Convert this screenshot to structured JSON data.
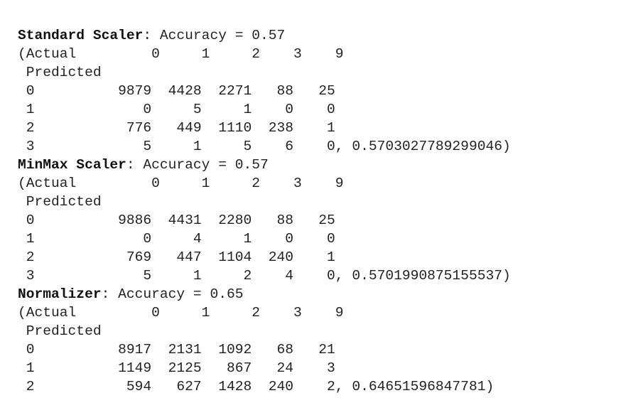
{
  "output": {
    "lines": [
      {
        "name": "standard-scaler-header",
        "bold": "Standard Scaler",
        "text": ": Accuracy = 0.57"
      },
      {
        "name": "standard-actual-row",
        "text": "(Actual         0     1     2    3    9"
      },
      {
        "name": "standard-predicted-label",
        "text": " Predicted"
      },
      {
        "name": "standard-row-0",
        "text": " 0          9879  4428  2271   88   25"
      },
      {
        "name": "standard-row-1",
        "text": " 1             0     5     1    0    0"
      },
      {
        "name": "standard-row-2",
        "text": " 2           776   449  1110  238    1"
      },
      {
        "name": "standard-row-3",
        "text": " 3             5     1     5    6    0, 0.5703027789299046)"
      },
      {
        "name": "minmax-scaler-header",
        "bold": "MinMax Scaler",
        "text": ": Accuracy = 0.57"
      },
      {
        "name": "minmax-actual-row",
        "text": "(Actual         0     1     2    3    9"
      },
      {
        "name": "minmax-predicted-label",
        "text": " Predicted"
      },
      {
        "name": "minmax-row-0",
        "text": " 0          9886  4431  2280   88   25"
      },
      {
        "name": "minmax-row-1",
        "text": " 1             0     4     1    0    0"
      },
      {
        "name": "minmax-row-2",
        "text": " 2           769   447  1104  240    1"
      },
      {
        "name": "minmax-row-3",
        "text": " 3             5     1     2    4    0, 0.5701990875155537)"
      },
      {
        "name": "normalizer-header",
        "bold": "Normalizer",
        "text": ": Accuracy = 0.65"
      },
      {
        "name": "normalizer-actual-row",
        "text": "(Actual         0     1     2    3    9"
      },
      {
        "name": "normalizer-predicted-label",
        "text": " Predicted"
      },
      {
        "name": "normalizer-row-0",
        "text": " 0          8917  2131  1092   68   21"
      },
      {
        "name": "normalizer-row-1",
        "text": " 1          1149  2125   867   24    3"
      },
      {
        "name": "normalizer-row-2",
        "text": " 2           594   627  1428  240    2, 0.64651596847781)"
      }
    ]
  }
}
